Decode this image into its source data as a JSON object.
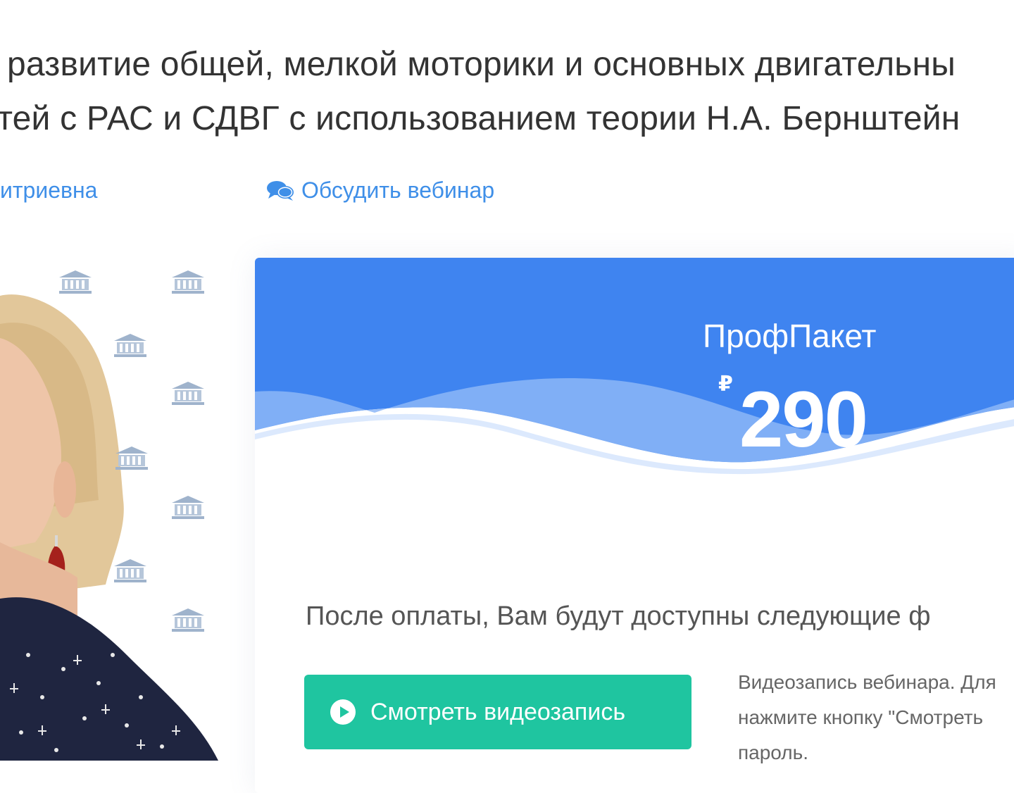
{
  "header": {
    "title_line1": "развитие общей, мелкой моторики и основных двигательны",
    "title_line2": "тей с РАС и СДВГ с использованием теории Н.А. Бернштейн"
  },
  "meta": {
    "author_link": "итриевна",
    "discuss_link": "Обсудить вебинар"
  },
  "card": {
    "plan_name": "ПрофПакет",
    "currency": "₽",
    "price": "290",
    "after_payment": "После оплаты, Вам будут доступны следующие ф",
    "watch_button": "Смотреть видеозапись",
    "watch_desc_line1": "Видеозапись вебинара. Для",
    "watch_desc_line2": "нажмите кнопку \"Смотреть",
    "watch_desc_line3": "пароль."
  },
  "colors": {
    "accent_blue": "#3f84f0",
    "wave_light": "#8cb6f7",
    "button_green": "#1fc5a0",
    "link_blue": "#3f8fe8"
  }
}
